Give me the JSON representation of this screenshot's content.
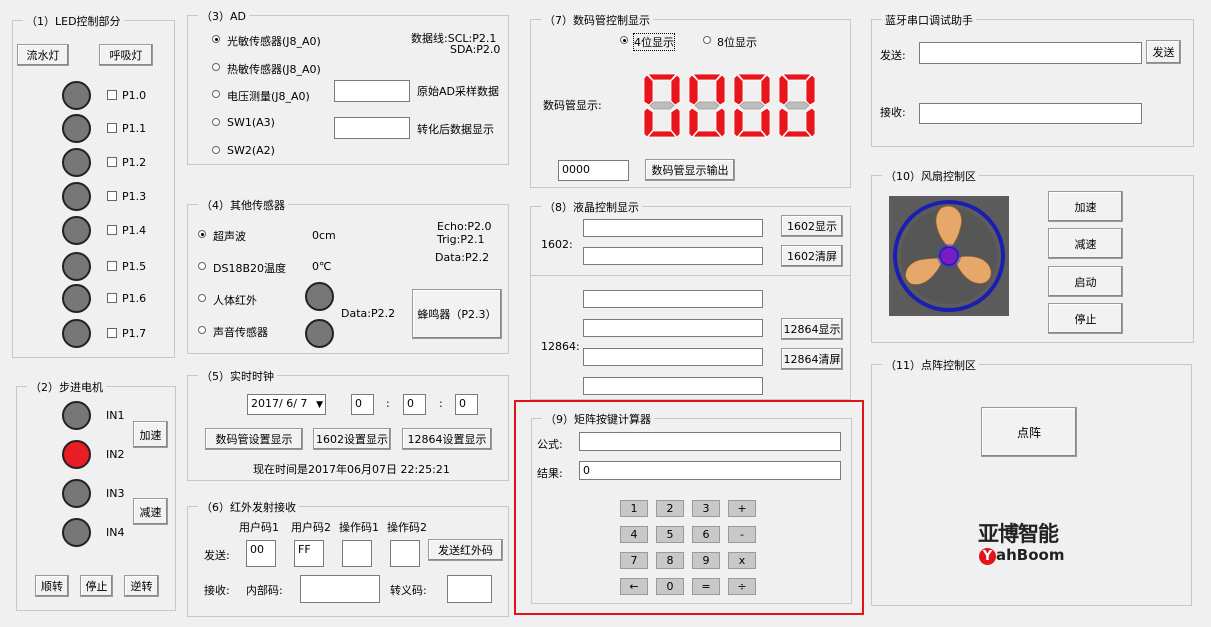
{
  "led": {
    "title": "（1）LED控制部分",
    "flow_btn": "流水灯",
    "breath_btn": "呼吸灯",
    "pins": [
      "P1.0",
      "P1.1",
      "P1.2",
      "P1.3",
      "P1.4",
      "P1.5",
      "P1.6",
      "P1.7"
    ]
  },
  "stepper": {
    "title": "（2）步进电机",
    "inputs": [
      "IN1",
      "IN2",
      "IN3",
      "IN4"
    ],
    "active_input": "IN2",
    "accel": "加速",
    "decel": "减速",
    "cw": "顺转",
    "stop": "停止",
    "ccw": "逆转"
  },
  "ad": {
    "title": "（3）AD",
    "options": [
      "光敏传感器(J8_A0)",
      "热敏传感器(J8_A0)",
      "电压测量(J8_A0)",
      "SW1(A3)",
      "SW2(A2)"
    ],
    "selected": "光敏传感器(J8_A0)",
    "bus_line1": "数据线:SCL:P2.1",
    "bus_line2": "SDA:P2.0",
    "raw_label": "原始AD采样数据",
    "conv_label": "转化后数据显示",
    "raw_value": "",
    "conv_value": ""
  },
  "sensors": {
    "title": "（4）其他传感器",
    "options": [
      "超声波",
      "DS18B20温度",
      "人体红外",
      "声音传感器"
    ],
    "selected": "超声波",
    "ultrasonic_value": "0cm",
    "temp_value": "0℃",
    "echo": "Echo:P2.0",
    "trig": "Trig:P2.1",
    "data1": "Data:P2.2",
    "data2": "Data:P2.2",
    "buzzer_btn": "蜂鸣器（P2.3）"
  },
  "rtc": {
    "title": "（5）实时时钟",
    "date": "2017/ 6/ 7",
    "hour": "0",
    "minute": "0",
    "second": "0",
    "sep": ":",
    "btn_seg": "数码管设置显示",
    "btn_1602": "1602设置显示",
    "btn_12864": "12864设置显示",
    "now_text": "现在时间是2017年06月07日 22:25:21"
  },
  "ir": {
    "title": "（6）红外发射接收",
    "col_user1": "用户码1",
    "col_user2": "用户码2",
    "col_op1": "操作码1",
    "col_op2": "操作码2",
    "send_label": "发送:",
    "user1": "00",
    "user2": "FF",
    "op1": "",
    "op2": "",
    "send_btn": "发送红外码",
    "recv_label": "接收:",
    "inner_label": "内部码:",
    "trans_label": "转义码:"
  },
  "segment": {
    "title": "（7）数码管控制显示",
    "opt4": "4位显示",
    "opt8": "8位显示",
    "selected": "4位显示",
    "display_label": "数码管显示:",
    "digits": [
      "0",
      "0",
      "0",
      "0"
    ],
    "input_value": "0000",
    "output_btn": "数码管显示输出",
    "color": "#e8161b"
  },
  "lcd": {
    "title": "（8）液晶控制显示",
    "label_1602": "1602:",
    "label_12864": "12864:",
    "btn_1602_show": "1602显示",
    "btn_1602_clear": "1602清屏",
    "btn_12864_show": "12864显示",
    "btn_12864_clear": "12864清屏"
  },
  "calc": {
    "title": "（9）矩阵按键计算器",
    "formula_label": "公式:",
    "result_label": "结果:",
    "formula": "",
    "result": "0",
    "keys": [
      [
        "1",
        "2",
        "3",
        "+"
      ],
      [
        "4",
        "5",
        "6",
        "-"
      ],
      [
        "7",
        "8",
        "9",
        "x"
      ],
      [
        "←",
        "0",
        "=",
        "÷"
      ]
    ],
    "highlight_color": "#e0141a"
  },
  "bt": {
    "title": "蓝牙串口调试助手",
    "send_label": "发送:",
    "send_btn": "发送",
    "recv_label": "接收:",
    "send_value": "",
    "recv_value": ""
  },
  "fan": {
    "title": "（10）风扇控制区",
    "accel": "加速",
    "decel": "减速",
    "start": "启动",
    "stop": "停止"
  },
  "dot": {
    "title": "（11）点阵控制区",
    "btn": "点阵"
  },
  "brand": {
    "cn": "亚博智能",
    "en_y": "Y",
    "en": "ahBoom"
  }
}
